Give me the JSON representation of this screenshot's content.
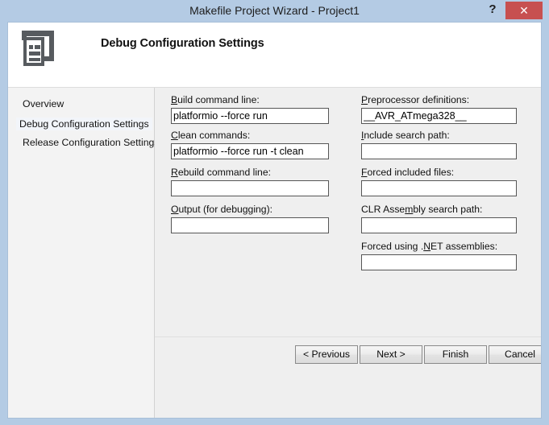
{
  "window": {
    "title": "Makefile Project Wizard - Project1",
    "help_label": "?",
    "close_label": "✕",
    "frame_color": "#b4cbe4",
    "close_color": "#c75050"
  },
  "header": {
    "title": "Debug Configuration Settings",
    "icon": "document-window-icon"
  },
  "sidebar": {
    "items": [
      {
        "label": "Overview",
        "selected": false
      },
      {
        "label": "Debug Configuration Settings",
        "selected": true
      },
      {
        "label": "Release Configuration Settings",
        "selected": false
      }
    ]
  },
  "form": {
    "left_column": [
      {
        "label_pre": "",
        "label_accel": "B",
        "label_post": "uild command line:",
        "value": "platformio --force run",
        "placeholder": "",
        "name": "build-command-line"
      },
      {
        "label_pre": "",
        "label_accel": "C",
        "label_post": "lean commands:",
        "value": "platformio --force run -t clean",
        "placeholder": "",
        "name": "clean-commands"
      },
      {
        "label_pre": "",
        "label_accel": "R",
        "label_post": "ebuild command line:",
        "value": "",
        "placeholder": "",
        "name": "rebuild-command-line"
      },
      {
        "label_pre": "",
        "label_accel": "O",
        "label_post": "utput (for debugging):",
        "value": "",
        "placeholder": "",
        "name": "output-for-debugging"
      }
    ],
    "right_column": [
      {
        "label_pre": "",
        "label_accel": "P",
        "label_post": "reprocessor definitions:",
        "value": "__AVR_ATmega328__",
        "placeholder": "",
        "name": "preprocessor-definitions"
      },
      {
        "label_pre": "",
        "label_accel": "I",
        "label_post": "nclude search path:",
        "value": "",
        "placeholder": "",
        "name": "include-search-path"
      },
      {
        "label_pre": "",
        "label_accel": "F",
        "label_post": "orced included files:",
        "value": "",
        "placeholder": "",
        "name": "forced-included-files"
      },
      {
        "label_pre": "CLR Asse",
        "label_accel": "m",
        "label_post": "bly search path:",
        "value": "",
        "placeholder": "",
        "name": "clr-assembly-search-path"
      },
      {
        "label_pre": "Forced using .",
        "label_accel": "N",
        "label_post": "ET assemblies:",
        "value": "",
        "placeholder": "",
        "name": "forced-using-net-assemblies"
      }
    ]
  },
  "buttons": [
    {
      "label": "< Previous",
      "name": "previous-button"
    },
    {
      "label": "Next >",
      "name": "next-button"
    },
    {
      "label": "Finish",
      "name": "finish-button"
    },
    {
      "label": "Cancel",
      "name": "cancel-button"
    }
  ]
}
